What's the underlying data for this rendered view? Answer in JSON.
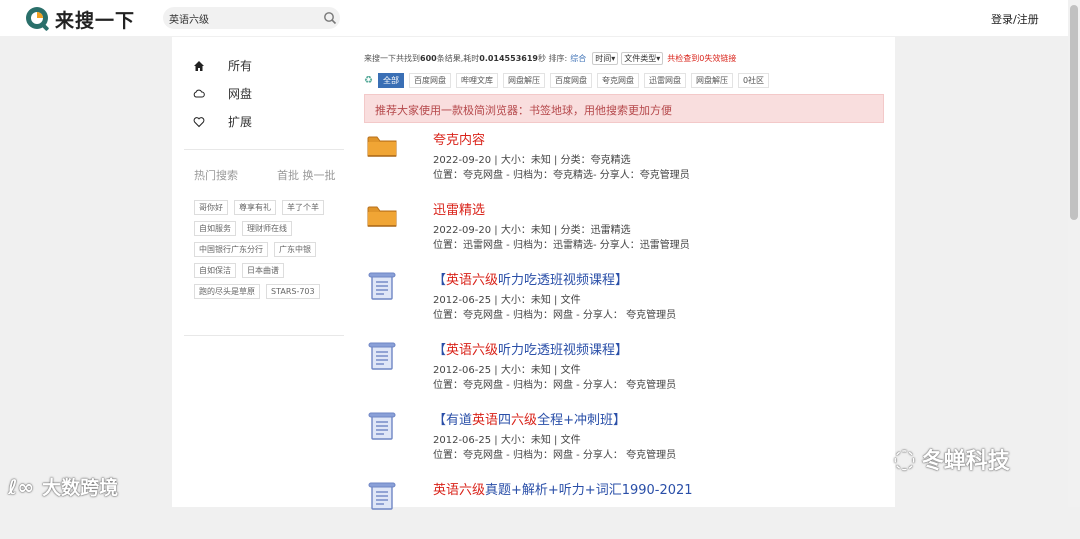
{
  "header": {
    "logo_text": "来搜一下",
    "search_value": "英语六级",
    "login_label": "登录/注册"
  },
  "sidebar": {
    "nav": [
      {
        "label": "所有",
        "icon": "home-icon"
      },
      {
        "label": "网盘",
        "icon": "cloud-icon"
      },
      {
        "label": "扩展",
        "icon": "heart-icon"
      }
    ],
    "hot_title": "热门搜索",
    "hot_more": "首批 换一批",
    "tags": [
      "哥你好",
      "尊享有礼",
      "羊了个羊",
      "自如服务",
      "理财师在线",
      "中国银行广东分行",
      "广东中银",
      "自如保洁",
      "日本曲谱",
      "跑的尽头是草原",
      "STARS-703"
    ]
  },
  "stats": {
    "prefix": "来搜一下共找到",
    "count": "600",
    "middle": "条结果,耗时",
    "time": "0.014553619",
    "suffix": "秒 排序:",
    "sort_active": "综合",
    "sort_time": "时间",
    "file_type": "文件类型",
    "invalid_links": "共检查到0失效链接"
  },
  "filters": [
    "全部",
    "百度网盘",
    "哔哩文库",
    "网盘解压",
    "百度网盘",
    "夸克网盘",
    "迅雷网盘",
    "网盘解压",
    "0社区"
  ],
  "alert": "推荐大家使用一款极简浏览器：书签地球，用他搜索更加方便",
  "results": [
    {
      "icon": "folder-icon",
      "title_parts": [
        {
          "text": "夸克内容",
          "color": "red"
        }
      ],
      "meta": "2022-09-20 | 大小：未知 | 分类：夸克精选",
      "loc": "位置：夸克网盘 - 归档为：夸克精选- 分享人：夸克管理员"
    },
    {
      "icon": "folder-icon",
      "title_parts": [
        {
          "text": "迅雷精选",
          "color": "red"
        }
      ],
      "meta": "2022-09-20 | 大小：未知 | 分类：迅雷精选",
      "loc": "位置：迅雷网盘 - 归档为：迅雷精选- 分享人：迅雷管理员"
    },
    {
      "icon": "document-icon",
      "title_parts": [
        {
          "text": "【",
          "color": "blue"
        },
        {
          "text": "英语六级",
          "color": "red"
        },
        {
          "text": "听力吃透班视频课程】",
          "color": "blue"
        }
      ],
      "meta": "2012-06-25 | 大小：未知 | 文件",
      "loc": "位置：夸克网盘 - 归档为：网盘 - 分享人：  夸克管理员"
    },
    {
      "icon": "document-icon",
      "title_parts": [
        {
          "text": "【",
          "color": "blue"
        },
        {
          "text": "英语六级",
          "color": "red"
        },
        {
          "text": "听力吃透班视频课程】",
          "color": "blue"
        }
      ],
      "meta": "2012-06-25 | 大小：未知 | 文件",
      "loc": "位置：夸克网盘 - 归档为：网盘 - 分享人：  夸克管理员"
    },
    {
      "icon": "document-icon",
      "title_parts": [
        {
          "text": "【有道",
          "color": "blue"
        },
        {
          "text": "英语",
          "color": "red"
        },
        {
          "text": "四",
          "color": "blue"
        },
        {
          "text": "六级",
          "color": "red"
        },
        {
          "text": "全程+冲刺班】",
          "color": "blue"
        }
      ],
      "meta": "2012-06-25 | 大小：未知 | 文件",
      "loc": "位置：夸克网盘 - 归档为：网盘 - 分享人：  夸克管理员"
    },
    {
      "icon": "document-icon",
      "title_parts": [
        {
          "text": "英语六级",
          "color": "red"
        },
        {
          "text": "真题+解析+听力+词汇1990-2021",
          "color": "blue"
        }
      ],
      "meta": "",
      "loc": ""
    }
  ],
  "watermarks": {
    "right": "冬蝉科技",
    "left": "大数跨境"
  },
  "colors": {
    "accent_blue": "#3a6fb5",
    "title_red": "#d9231a",
    "title_blue": "#2a4fa8",
    "folder": "#e0952a",
    "alert_bg": "#f9dede"
  }
}
